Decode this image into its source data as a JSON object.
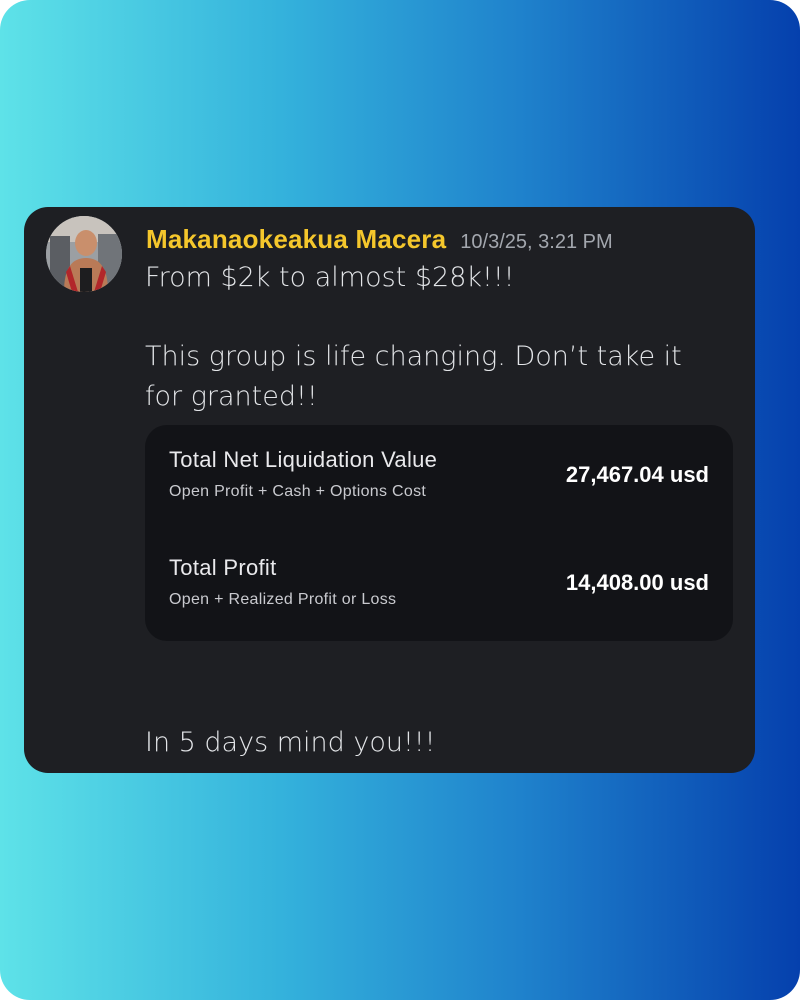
{
  "message": {
    "username": "Makanaokeakua Macera",
    "timestamp": "10/3/25, 3:21 PM",
    "line1": "From $2k to almost $28k!!!",
    "line2": "This group is life changing. Don’t take it for granted!!",
    "line3": "In 5 days mind you!!!",
    "accent_color": "#f5c72c"
  },
  "account_card": {
    "rows": [
      {
        "title": "Total Net Liquidation Value",
        "subtitle": "Open Profit + Cash + Options Cost",
        "value": "27,467.04 usd"
      },
      {
        "title": "Total Profit",
        "subtitle": "Open + Realized Profit or Loss",
        "value": "14,408.00 usd"
      }
    ]
  }
}
